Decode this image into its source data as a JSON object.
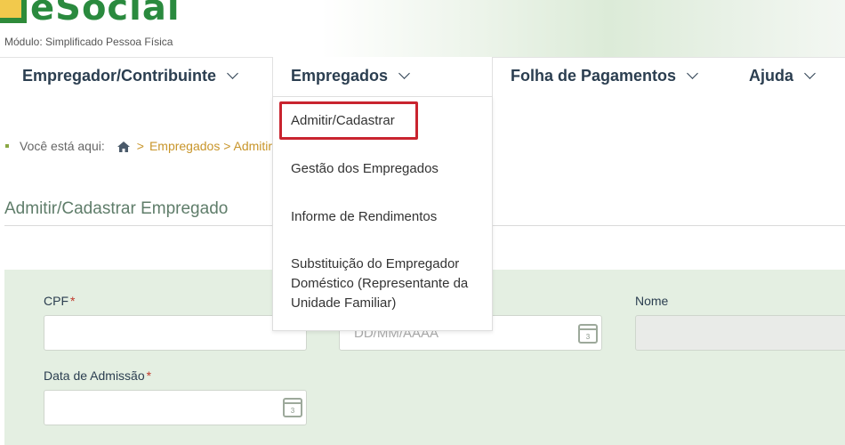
{
  "header": {
    "logo_text": "eSocial",
    "module_label": "Módulo: Simplificado Pessoa Física"
  },
  "nav": {
    "items": [
      {
        "label": "Empregador/Contribuinte"
      },
      {
        "label": "Empregados"
      },
      {
        "label": "Folha de Pagamentos"
      },
      {
        "label": "Ajuda"
      }
    ],
    "active": "Empregados"
  },
  "dropdown": {
    "items": [
      {
        "label": "Admitir/Cadastrar",
        "highlighted": true
      },
      {
        "label": "Gestão dos Empregados"
      },
      {
        "label": "Informe de Rendimentos"
      },
      {
        "label": "Substituição do Empregador Doméstico (Representante da Unidade Familiar)"
      }
    ]
  },
  "breadcrumb": {
    "prefix": "Você está aqui:",
    "separator": ">",
    "trail": "Empregados > Admitir/C"
  },
  "page": {
    "title": "Admitir/Cadastrar Empregado"
  },
  "form": {
    "cpf_label": "CPF",
    "date_placeholder": "DD/MM/AAAA",
    "nome_label": "Nome",
    "admissao_label": "Data de Admissão",
    "required_mark": "*",
    "calendar_day": "3"
  },
  "colors": {
    "brand_green": "#2a8a3e",
    "link_gold": "#c8952a",
    "highlight_red": "#c9242f",
    "panel_green": "#e4efe2"
  }
}
